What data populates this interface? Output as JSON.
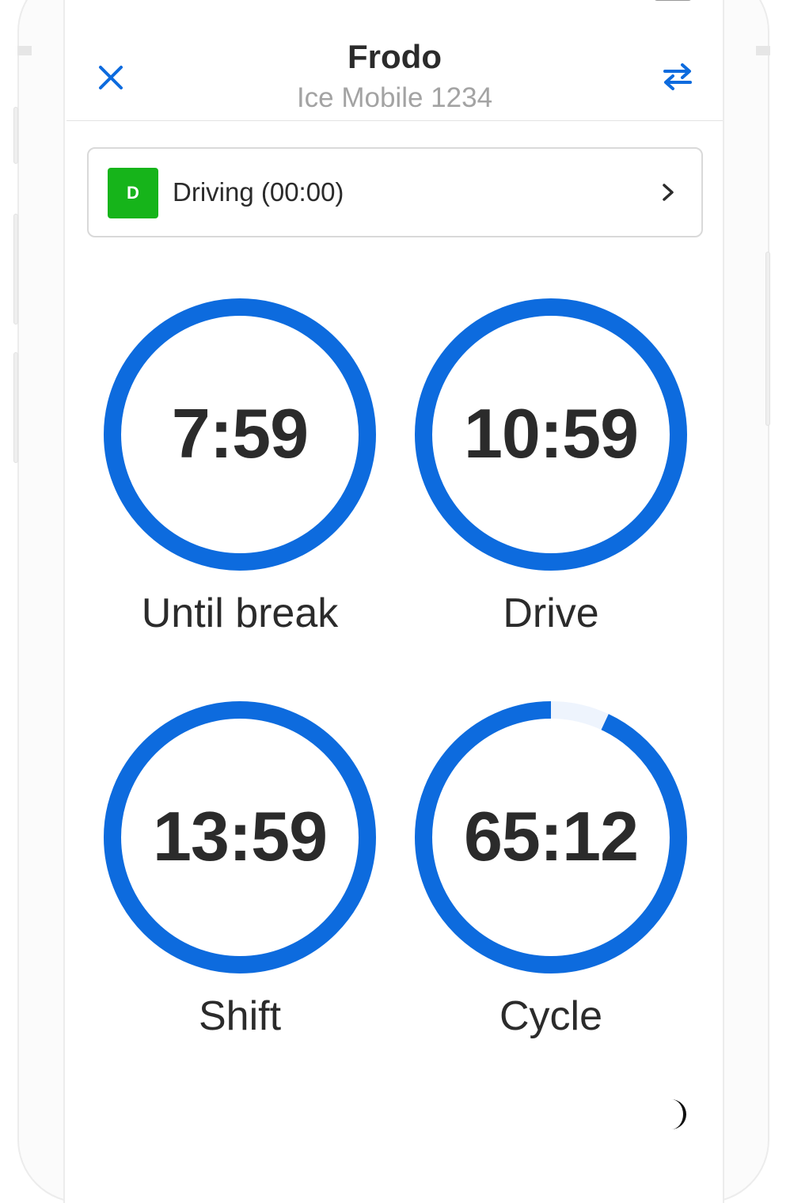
{
  "header": {
    "title": "Frodo",
    "subtitle": "Ice Mobile 1234",
    "close_icon": "close-icon",
    "switch_icon": "swap-arrows-icon"
  },
  "status": {
    "badge": "D",
    "text": "Driving (00:00)",
    "badge_color": "#16b41a",
    "chevron_icon": "chevron-right-icon"
  },
  "gauges": [
    {
      "value": "7:59",
      "label": "Until break",
      "progress": 1.0
    },
    {
      "value": "10:59",
      "label": "Drive",
      "progress": 1.0
    },
    {
      "value": "13:59",
      "label": "Shift",
      "progress": 1.0
    },
    {
      "value": "65:12",
      "label": "Cycle",
      "progress": 0.93
    }
  ],
  "colors": {
    "accent": "#0d6bde",
    "track": "#eef4fd",
    "text": "#2b2b2b",
    "subtext": "#a3a3a3"
  },
  "footer": {
    "theme_icon": "moon-icon"
  }
}
